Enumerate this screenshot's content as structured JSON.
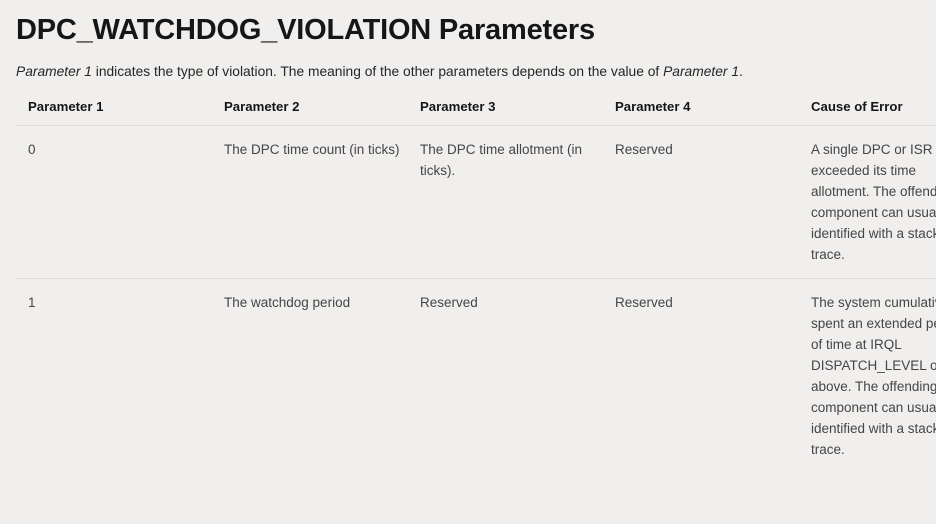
{
  "page": {
    "title": "DPC_WATCHDOG_VIOLATION Parameters",
    "intro": {
      "emphasis_lead": "Parameter 1",
      "text_middle": " indicates the type of violation. The meaning of the other parameters depends on the value of ",
      "emphasis_trail": "Parameter 1",
      "text_end": "."
    },
    "background_color": "#f0efee",
    "divider_color": "#dedddc",
    "title_color": "#161616",
    "body_text_color": "#454545"
  },
  "table": {
    "headers": [
      "Parameter 1",
      "Parameter 2",
      "Parameter 3",
      "Parameter 4",
      "Cause of Error"
    ],
    "rows": [
      {
        "parameter_1": "0",
        "parameter_2": "The DPC time count (in ticks)",
        "parameter_3": "The DPC time allotment (in ticks).",
        "parameter_4": "Reserved",
        "cause_of_error": "A single DPC or ISR exceeded its time allotment. The offending component can usually be identified with a stack trace."
      },
      {
        "parameter_1": "1",
        "parameter_2": "The watchdog period",
        "parameter_3": "Reserved",
        "parameter_4": "Reserved",
        "cause_of_error": "The system cumulatively spent an extended period of time at IRQL DISPATCH_LEVEL or above. The offending component can usually be identified with a stack trace."
      }
    ]
  }
}
